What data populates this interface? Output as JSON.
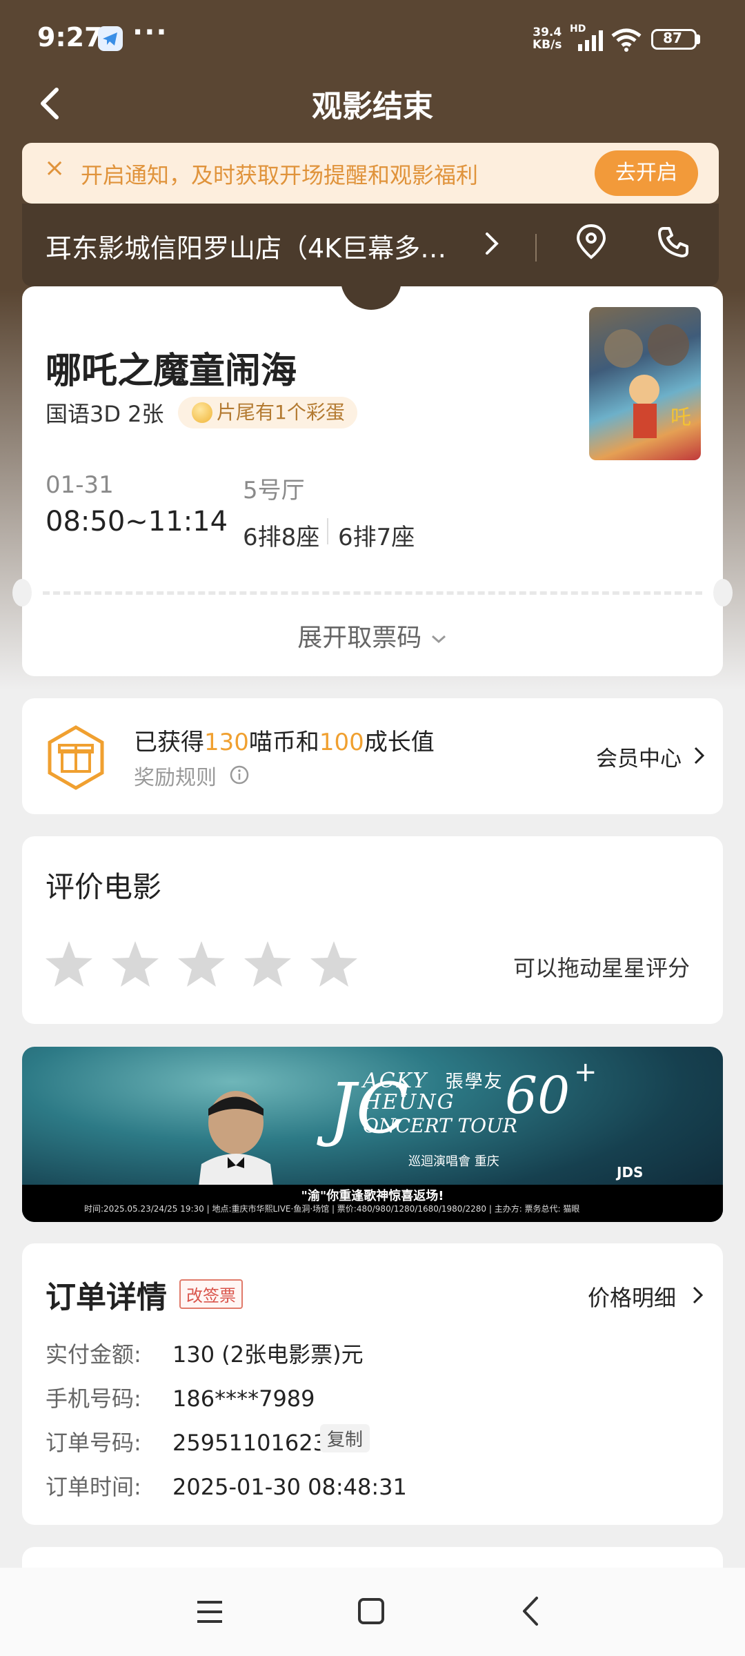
{
  "status_bar": {
    "time": "9:27",
    "dots": "···",
    "net_speed_value": "39.4",
    "net_speed_unit": "KB/s",
    "hd": "HD",
    "battery": "87"
  },
  "header": {
    "title": "观影结束",
    "back_icon": "chevron-left-icon"
  },
  "notification": {
    "text": "开启通知，及时获取开场提醒和观影福利",
    "button": "去开启",
    "close_icon": "close-icon",
    "accent_color": "#f29a3a"
  },
  "cinema": {
    "name": "耳东影城信阳罗山店（4K巨幕多…",
    "location_icon": "location-pin-icon",
    "phone_icon": "phone-icon"
  },
  "movie": {
    "title": "哪吒之魔童闹海",
    "format": "国语3D 2张",
    "easter_egg": "片尾有1个彩蛋",
    "date": "01-31",
    "time_range": "08:50~11:14",
    "hall": "5号厅",
    "seats": [
      "6排8座",
      "6排7座"
    ],
    "expand_code": "展开取票码"
  },
  "rewards": {
    "prefix": "已获得",
    "coins": "130",
    "coins_unit": "喵币和",
    "growth": "100",
    "growth_unit": "成长值",
    "rules": "奖励规则",
    "member_center": "会员中心",
    "accent_color": "#f0a030"
  },
  "rating": {
    "title": "评价电影",
    "hint": "可以拖动星星评分",
    "stars_total": 5,
    "stars_filled": 0
  },
  "ad": {
    "line1": "ACKY",
    "line2": "HEUNG",
    "line3": "ONCERT TOUR",
    "chinese_name": "張學友",
    "sixty": "60",
    "plus": "+",
    "subtitle": "巡迴演唱會 重庆",
    "brand": "JDS",
    "slogan": "\"渝\"你重逢歌神惊喜返场!",
    "info": "时间:2025.05.23/24/25  19:30  |  地点:重庆市华熙LIVE·鱼洞·场馆  |  票价:480/980/1280/1680/1980/2280  |  主办方:  票务总代: 猫眼"
  },
  "order": {
    "title": "订单详情",
    "tag": "改签票",
    "price_detail": "价格明细",
    "rows": [
      {
        "label": "实付金额:",
        "value": "130 (2张电影票)元"
      },
      {
        "label": "手机号码:",
        "value": "186****7989"
      },
      {
        "label": "订单号码:",
        "value": "25951101623"
      },
      {
        "label": "订单时间:",
        "value": "2025-01-30 08:48:31"
      }
    ],
    "copy": "复制"
  },
  "nav": {
    "menu_icon": "menu-icon",
    "home_icon": "home-square-icon",
    "back_icon": "back-triangle-icon"
  }
}
